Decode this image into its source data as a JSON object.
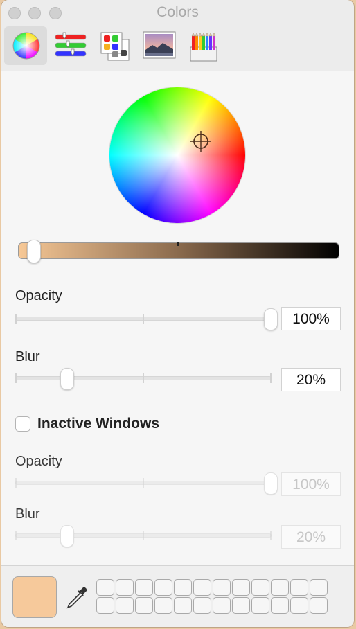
{
  "window": {
    "title": "Colors"
  },
  "toolbar": {
    "items": [
      {
        "name": "color-wheel",
        "active": true
      },
      {
        "name": "color-sliders"
      },
      {
        "name": "color-palettes"
      },
      {
        "name": "image-palettes"
      },
      {
        "name": "pencils"
      }
    ]
  },
  "color": {
    "current": "#f6c99b",
    "brightness_percent": 4
  },
  "active": {
    "opacity_label": "Opacity",
    "opacity_value": "100%",
    "opacity_percent": 100,
    "blur_label": "Blur",
    "blur_value": "20%",
    "blur_percent": 20
  },
  "inactive": {
    "checkbox_label": "Inactive Windows",
    "checked": false,
    "opacity_label": "Opacity",
    "opacity_value": "100%",
    "opacity_percent": 100,
    "blur_label": "Blur",
    "blur_value": "20%",
    "blur_percent": 20
  },
  "swatch_grid": {
    "columns": 12,
    "rows": 2
  }
}
